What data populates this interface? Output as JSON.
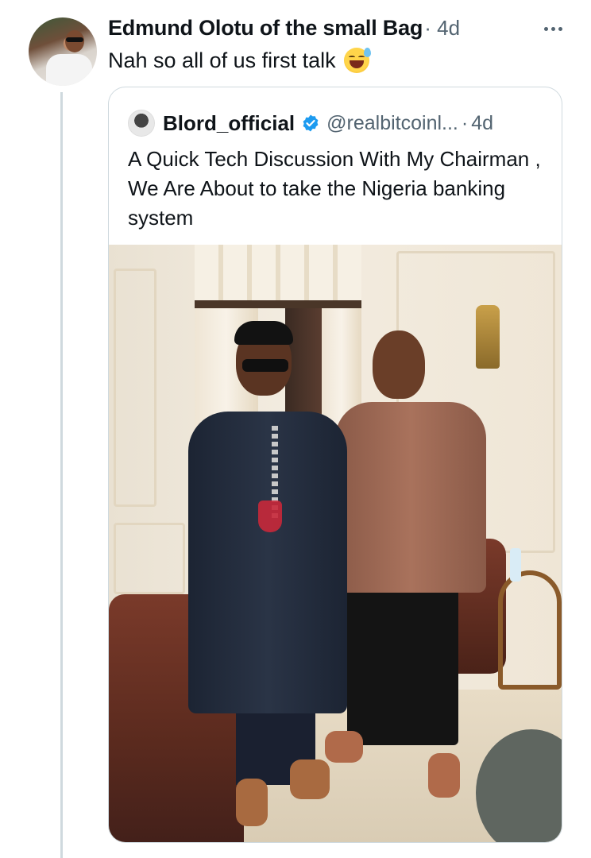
{
  "post": {
    "author": "Edmund Olotu of the small Bag",
    "separator": "·",
    "time": "4d",
    "text": "Nah so all of us first talk",
    "emoji": "grinning-face-with-sweat"
  },
  "quoted": {
    "name": "Blord_official",
    "verified": true,
    "handle": "@realbitcoinl...",
    "separator": "·",
    "time": "4d",
    "text": "A Quick Tech Discussion With My Chairman , We Are About to take the Nigeria banking system"
  },
  "colors": {
    "primary_text": "#0f1419",
    "secondary_text": "#536471",
    "border": "#cfd9de",
    "verified_blue": "#1d9bf0"
  }
}
